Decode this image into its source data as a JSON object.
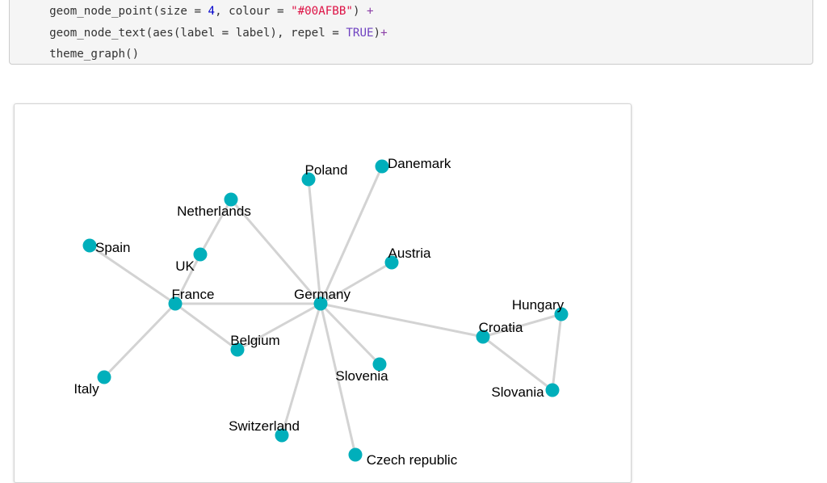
{
  "code_block": {
    "lines": [
      [
        {
          "t": "  geom_node_point(size = ",
          "c": ""
        },
        {
          "t": "4",
          "c": "tok-num"
        },
        {
          "t": ", colour = ",
          "c": ""
        },
        {
          "t": "\"#00AFBB\"",
          "c": "tok-str"
        },
        {
          "t": ") ",
          "c": ""
        },
        {
          "t": "+",
          "c": "tok-op"
        }
      ],
      [
        {
          "t": "  geom_node_text(aes(label = label), repel = ",
          "c": ""
        },
        {
          "t": "TRUE",
          "c": "tok-kw"
        },
        {
          "t": ")",
          "c": ""
        },
        {
          "t": "+",
          "c": "tok-op"
        }
      ],
      [
        {
          "t": "  theme_graph()",
          "c": ""
        }
      ]
    ]
  },
  "graph": {
    "node_color": "#00AFBB",
    "edge_color": "#d3d3d3",
    "nodes": [
      {
        "id": "Germany",
        "label": "Germany"
      },
      {
        "id": "France",
        "label": "France"
      },
      {
        "id": "Poland",
        "label": "Poland"
      },
      {
        "id": "Danemark",
        "label": "Danemark"
      },
      {
        "id": "Netherlands",
        "label": "Netherlands"
      },
      {
        "id": "Spain",
        "label": "Spain"
      },
      {
        "id": "UK",
        "label": "UK"
      },
      {
        "id": "Austria",
        "label": "Austria"
      },
      {
        "id": "Belgium",
        "label": "Belgium"
      },
      {
        "id": "Hungary",
        "label": "Hungary"
      },
      {
        "id": "Croatia",
        "label": "Croatia"
      },
      {
        "id": "Slovenia",
        "label": "Slovenia"
      },
      {
        "id": "Slovania",
        "label": "Slovania"
      },
      {
        "id": "Italy",
        "label": "Italy"
      },
      {
        "id": "Switzerland",
        "label": "Switzerland"
      },
      {
        "id": "Czech republic",
        "label": "Czech republic"
      }
    ],
    "edges": [
      [
        "Germany",
        "France"
      ],
      [
        "Germany",
        "Poland"
      ],
      [
        "Germany",
        "Danemark"
      ],
      [
        "Germany",
        "Netherlands"
      ],
      [
        "Germany",
        "Austria"
      ],
      [
        "Germany",
        "Belgium"
      ],
      [
        "Germany",
        "Slovenia"
      ],
      [
        "Germany",
        "Switzerland"
      ],
      [
        "Germany",
        "Czech republic"
      ],
      [
        "Germany",
        "Croatia"
      ],
      [
        "France",
        "Spain"
      ],
      [
        "France",
        "UK"
      ],
      [
        "France",
        "Belgium"
      ],
      [
        "France",
        "Italy"
      ],
      [
        "UK",
        "Netherlands"
      ],
      [
        "Croatia",
        "Hungary"
      ],
      [
        "Croatia",
        "Slovania"
      ],
      [
        "Hungary",
        "Slovania"
      ]
    ]
  }
}
